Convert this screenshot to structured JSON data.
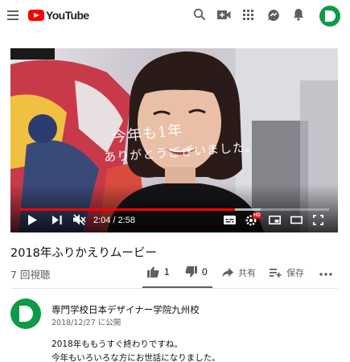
{
  "header": {
    "logo_text": "YouTube",
    "icons": [
      "menu-icon",
      "search-icon",
      "create-video-icon",
      "apps-grid-icon",
      "messages-icon",
      "notifications-bell-icon",
      "account-avatar"
    ],
    "brand_color": "#ff0000",
    "avatar_color": "#0f9a4a"
  },
  "player": {
    "overlay_caption_line1": "今年も1年",
    "overlay_caption_line2": "ありがとうございました。",
    "current_time": "2:04",
    "duration": "2:58",
    "time_display": "2:04 / 2:58",
    "progress_fraction": 0.697,
    "buffered_fraction": 0.78,
    "hd_badge": "HD",
    "progress_color": "#ff0000"
  },
  "video": {
    "title": "2018年ふりかえりムービー",
    "views": "7 回視聴",
    "likes": "1",
    "dislikes": "0",
    "share_label": "共有",
    "save_label": "保存",
    "like_ratio": 1.0
  },
  "channel": {
    "name": "専門学校日本デザイナー学院九州校",
    "published": "2018/12/27 に公開"
  },
  "description": {
    "line1": "2018年ももうすぐ終わりですね。",
    "line2": "今年もいろいろな方にお世話になりました。"
  }
}
